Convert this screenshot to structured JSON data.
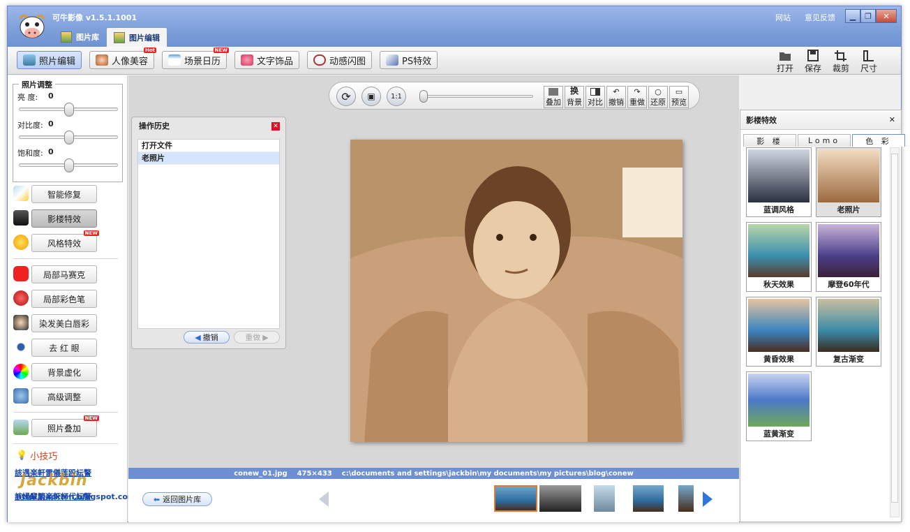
{
  "app": {
    "title": "可牛影像 v1.5.1.1001",
    "tabs": [
      {
        "label": "图片库"
      },
      {
        "label": "图片编辑"
      }
    ],
    "links": [
      "网站",
      "意见反馈"
    ]
  },
  "toolbar": {
    "items": [
      "照片编辑",
      "人像美容",
      "场景日历",
      "文字饰品",
      "动感闪图",
      "PS特效"
    ],
    "badges": {
      "hot": "Hot",
      "new": "NEW"
    },
    "right": [
      "打开",
      "保存",
      "裁剪",
      "尺寸"
    ]
  },
  "adjust": {
    "title": "照片调整",
    "brightness_label": "亮 度:",
    "brightness": "0",
    "contrast_label": "对比度:",
    "contrast": "0",
    "saturation_label": "饱和度:",
    "saturation": "0"
  },
  "leftbuttons": [
    "智能修复",
    "影楼特效",
    "风格特效",
    "局部马赛克",
    "局部彩色笔",
    "染发美白唇彩",
    "去 红 眼",
    "背景虚化",
    "高级调整",
    "照片叠加"
  ],
  "tips": {
    "title": "小技巧",
    "links": [
      "該遇楽軒雷儀莲殴紜警",
      "",
      "該婦輩繁楽軒杯代紜警"
    ],
    "watermark": "Jackbin",
    "watermark_url": "http://jackbin.blogspot.com"
  },
  "phototools": {
    "zoom_label": "1:1",
    "buttons": [
      "叠加",
      "背景",
      "对比",
      "撤销",
      "重做",
      "还原",
      "预览"
    ],
    "swap_label": "换"
  },
  "history": {
    "title": "操作历史",
    "items": [
      "打开文件",
      "老照片"
    ],
    "undo": "撤销",
    "redo": "重做"
  },
  "status": {
    "file": "conew_01.jpg",
    "dims": "475×433",
    "path": "c:\\documents and settings\\jackbin\\my documents\\my pictures\\blog\\conew"
  },
  "film": {
    "back": "返回图片库"
  },
  "effects": {
    "title": "影楼特效",
    "tabs": [
      "影 楼",
      "Lomo",
      "色 彩"
    ],
    "items": [
      "蓝调风格",
      "老照片",
      "秋天效果",
      "摩登60年代",
      "黄昏效果",
      "复古渐变",
      "蓝黄渐变"
    ]
  },
  "colors": {
    "title_bar": "#7c9ed9",
    "accent": "#2d76e0",
    "selected_border": "#e07a3a"
  }
}
